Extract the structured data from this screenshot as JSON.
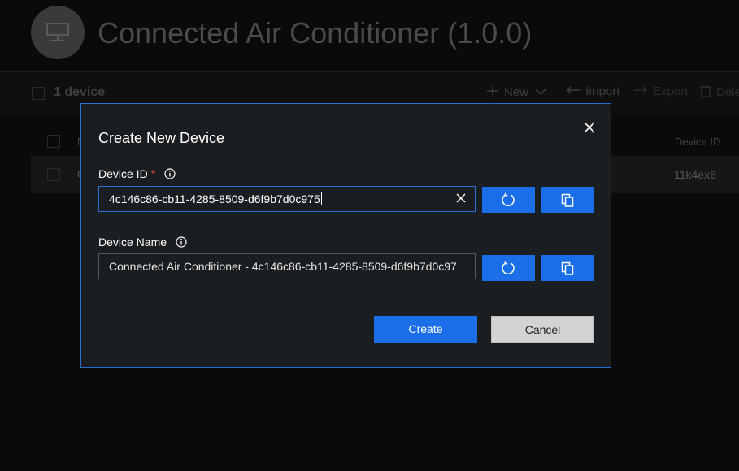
{
  "header": {
    "title": "Connected Air Conditioner (1.0.0)",
    "icon": "device-icon"
  },
  "command_bar": {
    "device_count": "1 device",
    "new_label": "New",
    "import_label": "Import",
    "export_label": "Export",
    "delete_label": "Dele"
  },
  "table": {
    "col_name_partial": "N",
    "col_device_id": "Device ID",
    "row": {
      "device_id": "11k4ex6",
      "name_partial": "C"
    }
  },
  "dialog": {
    "title": "Create New Device",
    "device_id_label": "Device ID",
    "required_mark": "*",
    "device_id_value": "4c146c86-cb11-4285-8509-d6f9b7d0c975",
    "device_name_label": "Device Name",
    "device_name_value": "Connected Air Conditioner - 4c146c86-cb11-4285-8509-d6f9b7d0c97",
    "create_label": "Create",
    "cancel_label": "Cancel"
  },
  "colors": {
    "accent": "#1a6fe8",
    "dialog_border": "#2b6fd6",
    "required": "#e0433d",
    "dialog_bg": "#1b1e21"
  }
}
